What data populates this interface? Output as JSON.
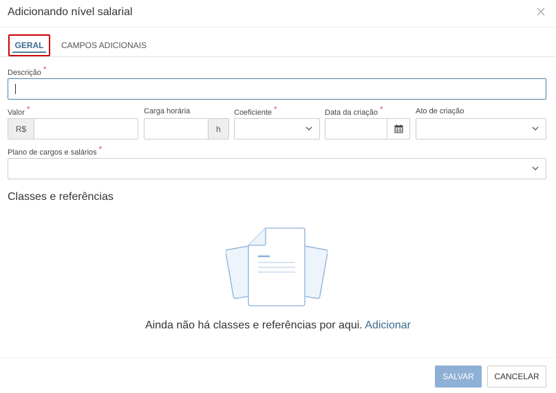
{
  "dialog": {
    "title": "Adicionando nível salarial",
    "close_icon": "close-icon"
  },
  "tabs": [
    {
      "label": "GERAL",
      "active": true
    },
    {
      "label": "CAMPOS ADICIONAIS",
      "active": false
    }
  ],
  "form": {
    "descricao": {
      "label": "Descrição",
      "required": "*",
      "value": ""
    },
    "valor": {
      "label": "Valor",
      "required": "*",
      "prefix": "R$",
      "value": ""
    },
    "carga_horaria": {
      "label": "Carga horária",
      "suffix": "h",
      "value": ""
    },
    "coeficiente": {
      "label": "Coeficiente",
      "required": "*",
      "value": ""
    },
    "data_criacao": {
      "label": "Data da criação",
      "required": "*",
      "value": "",
      "icon": "calendar-icon"
    },
    "ato_criacao": {
      "label": "Ato de criação",
      "value": ""
    },
    "plano": {
      "label": "Plano de cargos e salários",
      "required": "*",
      "value": ""
    }
  },
  "classes": {
    "title": "Classes e referências",
    "empty_text": "Ainda não há classes e referências por aqui.",
    "add_link": "Adicionar"
  },
  "footer": {
    "save_label": "SALVAR",
    "cancel_label": "CANCELAR"
  },
  "colors": {
    "accent": "#4a7fa5",
    "required": "#d9534f",
    "save_button": "#8db0d4",
    "tab_highlight": "#cc0000"
  }
}
